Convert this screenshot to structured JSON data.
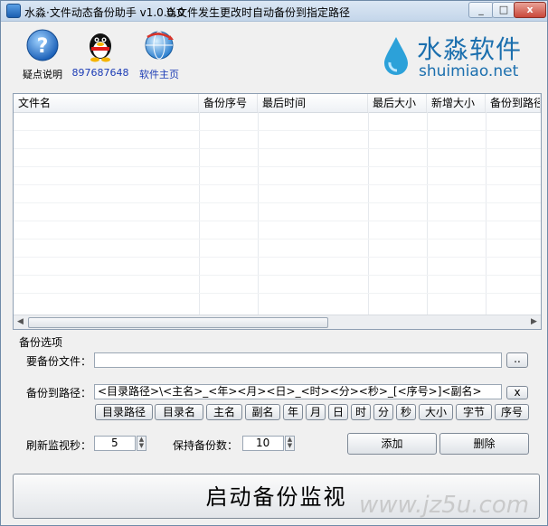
{
  "window": {
    "title": "水淼·文件动态备份助手 v1.0.0.0",
    "subtitle": "当文件发生更改时自动备份到指定路径",
    "controls": [
      "_",
      "□",
      "x"
    ]
  },
  "toolbar": {
    "help_label": "疑点说明",
    "qq_label": "897687648",
    "home_label": "软件主页"
  },
  "logo": {
    "cn": "水淼软件",
    "en": "shuimiao.net",
    "brand_color": "#1b6fae"
  },
  "table": {
    "columns": [
      "文件名",
      "备份序号",
      "最后时间",
      "最后大小",
      "新增大小",
      "备份到路径"
    ],
    "rows": []
  },
  "options": {
    "section_title": "备份选项",
    "file_label": "要备份文件：",
    "file_value": "",
    "browse_label": "..",
    "path_label": "备份到路径：",
    "path_value": "<目录路径>\\<主名>_<年><月><日>_<时><分><秒>_[<序号>]<副名>",
    "clear_label": "x",
    "tokens": [
      "目录路径",
      "目录名",
      "主名",
      "副名",
      "年",
      "月",
      "日",
      "时",
      "分",
      "秒",
      "大小",
      "字节",
      "序号"
    ],
    "refresh_label": "刷新监视秒：",
    "refresh_value": "5",
    "keep_label": "保持备份数：",
    "keep_value": "10",
    "add_label": "添加",
    "delete_label": "删除"
  },
  "start_button": "启动备份监视",
  "watermark": "www.jz5u.com"
}
